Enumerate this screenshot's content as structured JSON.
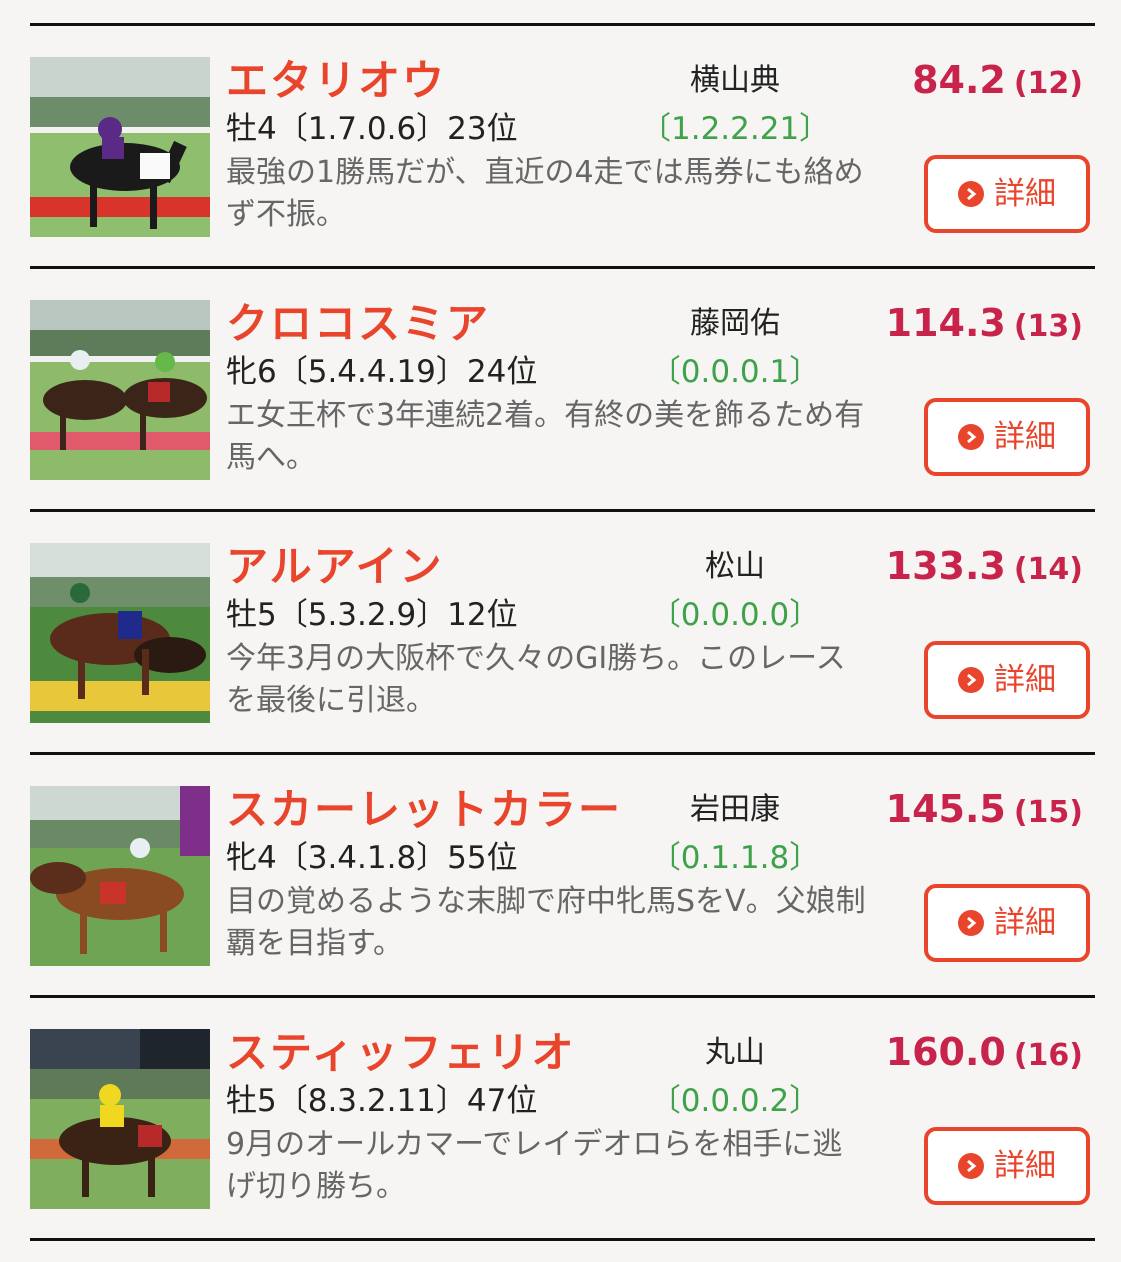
{
  "horses": [
    {
      "name": "エタリオウ",
      "jockey": "横山典",
      "odds": "84.2",
      "rank": "(12)",
      "profile": "牡4〔1.7.0.6〕23位",
      "record": "〔1.2.2.21〕",
      "comment": "最強の1勝馬だが、直近の4走では馬券にも絡めず不振。",
      "detail_label": "詳細"
    },
    {
      "name": "クロコスミア",
      "jockey": "藤岡佑",
      "odds": "114.3",
      "rank": "(13)",
      "profile": "牝6〔5.4.4.19〕24位",
      "record": "〔0.0.0.1〕",
      "comment": "エ女王杯で3年連続2着。有終の美を飾るため有馬へ。",
      "detail_label": "詳細"
    },
    {
      "name": "アルアイン",
      "jockey": "松山",
      "odds": "133.3",
      "rank": "(14)",
      "profile": "牡5〔5.3.2.9〕12位",
      "record": "〔0.0.0.0〕",
      "comment": "今年3月の大阪杯で久々のGI勝ち。このレースを最後に引退。",
      "detail_label": "詳細"
    },
    {
      "name": "スカーレットカラー",
      "jockey": "岩田康",
      "odds": "145.5",
      "rank": "(15)",
      "profile": "牝4〔3.4.1.8〕55位",
      "record": "〔0.1.1.8〕",
      "comment": "目の覚めるような末脚で府中牝馬SをV。父娘制覇を目指す。",
      "detail_label": "詳細"
    },
    {
      "name": "スティッフェリオ",
      "jockey": "丸山",
      "odds": "160.0",
      "rank": "(16)",
      "profile": "牡5〔8.3.2.11〕47位",
      "record": "〔0.0.0.2〕",
      "comment": "9月のオールカマーでレイデオロらを相手に逃げ切り勝ち。",
      "detail_label": "詳細"
    }
  ],
  "colors": {
    "name": "#e8452c",
    "odds": "#c8234a",
    "record": "#3da24a",
    "button": "#e8452c"
  }
}
